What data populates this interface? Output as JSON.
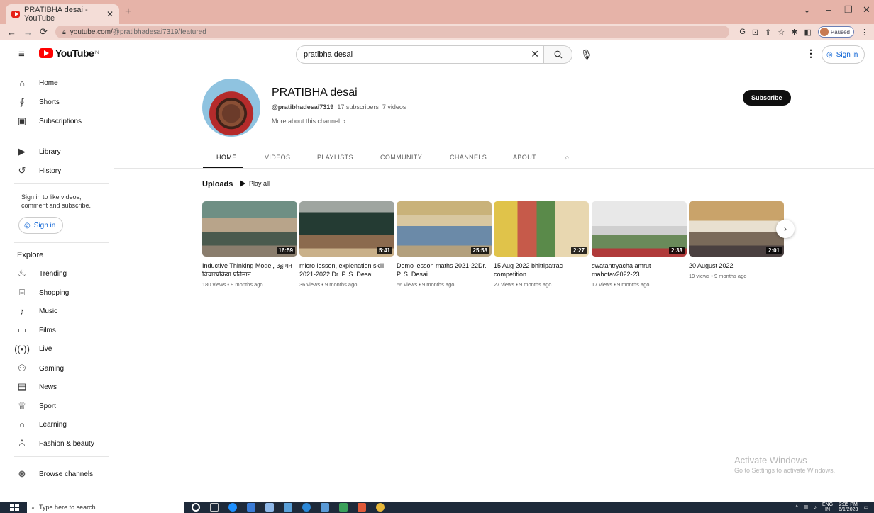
{
  "browser": {
    "tab_title": "PRATIBHA desai - YouTube",
    "url_host": "youtube.com/",
    "url_path": "@pratibhadesai7319/featured",
    "paused_label": "Paused"
  },
  "header": {
    "logo_text": "YouTube",
    "logo_region": "IN",
    "search_value": "pratibha desai",
    "sign_in": "Sign in"
  },
  "sidebar": {
    "main": [
      {
        "label": "Home",
        "icon": "home-icon"
      },
      {
        "label": "Shorts",
        "icon": "shorts-icon"
      },
      {
        "label": "Subscriptions",
        "icon": "subscriptions-icon"
      }
    ],
    "library": [
      {
        "label": "Library",
        "icon": "library-icon"
      },
      {
        "label": "History",
        "icon": "history-icon"
      }
    ],
    "signin_note": "Sign in to like videos, comment and subscribe.",
    "signin_button": "Sign in",
    "explore_heading": "Explore",
    "explore": [
      {
        "label": "Trending",
        "icon": "trending-icon"
      },
      {
        "label": "Shopping",
        "icon": "shopping-icon"
      },
      {
        "label": "Music",
        "icon": "music-icon"
      },
      {
        "label": "Films",
        "icon": "films-icon"
      },
      {
        "label": "Live",
        "icon": "live-icon"
      },
      {
        "label": "Gaming",
        "icon": "gaming-icon"
      },
      {
        "label": "News",
        "icon": "news-icon"
      },
      {
        "label": "Sport",
        "icon": "sport-icon"
      },
      {
        "label": "Learning",
        "icon": "learning-icon"
      },
      {
        "label": "Fashion & beauty",
        "icon": "fashion-icon"
      }
    ],
    "browse_channels": "Browse channels"
  },
  "channel": {
    "name": "PRATIBHA desai",
    "handle": "@pratibhadesai7319",
    "subscribers": "17 subscribers",
    "videos_count": "7 videos",
    "more_about": "More about this channel",
    "subscribe": "Subscribe"
  },
  "tabs": [
    "HOME",
    "VIDEOS",
    "PLAYLISTS",
    "COMMUNITY",
    "CHANNELS",
    "ABOUT"
  ],
  "uploads": {
    "heading": "Uploads",
    "play_all": "Play all",
    "videos": [
      {
        "title": "Inductive Thinking Model, उद्गामन विचारप्रक्रिया प्रतिमान",
        "duration": "16:59",
        "meta": "180 views • 9 months ago"
      },
      {
        "title": "micro lesson, explenation skill 2021-2022 Dr. P. S. Desai",
        "duration": "5:41",
        "meta": "36 views • 9 months ago"
      },
      {
        "title": "Demo lesson maths 2021-22Dr. P. S. Desai",
        "duration": "25:58",
        "meta": "56 views • 9 months ago"
      },
      {
        "title": "15 Aug 2022 bhittipatrac competition",
        "duration": "2:27",
        "meta": "27 views • 9 months ago"
      },
      {
        "title": "swatantryacha amrut mahotav2022-23",
        "duration": "2:33",
        "meta": "17 views • 9 months ago"
      },
      {
        "title": "20 August 2022",
        "duration": "2:01",
        "meta": "19 views • 9 months ago"
      }
    ]
  },
  "watermark": {
    "line1": "Activate Windows",
    "line2": "Go to Settings to activate Windows."
  },
  "taskbar": {
    "search_placeholder": "Type here to search",
    "lang": "ENG",
    "region": "IN",
    "time": "2:35 PM",
    "date": "6/1/2023"
  }
}
